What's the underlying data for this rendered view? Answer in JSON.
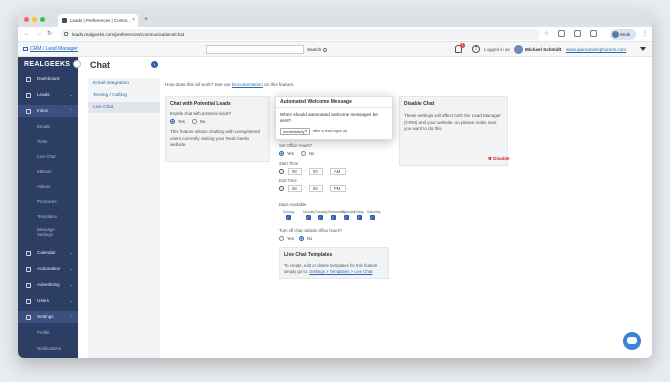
{
  "browser": {
    "tab_title": "Leads | Preferences | Comm...",
    "tab_close": "×",
    "new_tab": "+",
    "url": "leads.realgeeks.com/preferences/communications/chat",
    "profile": "Work"
  },
  "header": {
    "crm_link": "CRM / Lead Manager",
    "search_button": "Search",
    "notification_count": "1",
    "logged_in_label": "Logged in as",
    "user_name": "Michael Schmidt",
    "site_link": "www.quincardenphomes.com"
  },
  "sidebar": {
    "logo": "REALGEEKS",
    "items": [
      {
        "label": "Dashboard"
      },
      {
        "label": "Leads"
      },
      {
        "label": "Inbox"
      },
      {
        "label": "Calendar"
      },
      {
        "label": "Automation"
      },
      {
        "label": "Advertising"
      },
      {
        "label": "Users"
      },
      {
        "label": "Settings"
      }
    ],
    "inbox_sub": [
      {
        "label": "Emails"
      },
      {
        "label": "Texts"
      },
      {
        "label": "Live Chat"
      },
      {
        "label": "eBlasts"
      },
      {
        "label": "Videos"
      },
      {
        "label": "Postcards"
      },
      {
        "label": "Templates"
      },
      {
        "label": "Message Settings"
      }
    ],
    "settings_sub": [
      {
        "label": "Profile"
      },
      {
        "label": "Notifications"
      }
    ]
  },
  "page": {
    "title": "Chat",
    "info_icon": "i",
    "subnav": [
      {
        "label": "Email Integration"
      },
      {
        "label": "Texting / Calling"
      },
      {
        "label": "Live Chat"
      }
    ],
    "how_text": "How does this all work? See our",
    "how_link": "Documentation",
    "how_suffix": "on this feature."
  },
  "chat_card": {
    "title": "Chat with Potential Leads",
    "question": "Enable chat with potential leads?",
    "yes": "Yes",
    "no": "No",
    "desc": "This feature allows chatting with unregistered users currently visiting your Real Geeks website."
  },
  "modal": {
    "title": "Automated Welcome Message",
    "question": "When should automated welcome messages be sent?",
    "select_value": "Immediately",
    "after_text": "after a lead signs up"
  },
  "hours": {
    "office_hours_label": "Set Office Hours?",
    "yes": "Yes",
    "no": "No",
    "start_label": "Start Time",
    "start_h": "08",
    "start_m": "00",
    "start_ampm": "AM",
    "end_label": "End Time",
    "end_h": "08",
    "end_m": "00",
    "end_ampm": "PM",
    "days_label": "Days Available",
    "days": [
      "Sunday",
      "Monday",
      "Tuesday",
      "Wednesday",
      "Thursday",
      "Friday",
      "Saturday"
    ],
    "check_glyph": "✓",
    "turnoff_label": "Turn off chat outside office hours?",
    "turnoff_yes": "Yes",
    "turnoff_no": "No"
  },
  "templates_card": {
    "title": "Live Chat Templates",
    "desc": "To create, edit or delete templates for this feature simply go to:",
    "link": "Settings > Templates > Live Chat"
  },
  "disable_card": {
    "title": "Disable Chat",
    "desc": "These settings will affect both the Lead Manager (CRM) and your website, so please make sure you want to do this.",
    "button": "Disable"
  }
}
